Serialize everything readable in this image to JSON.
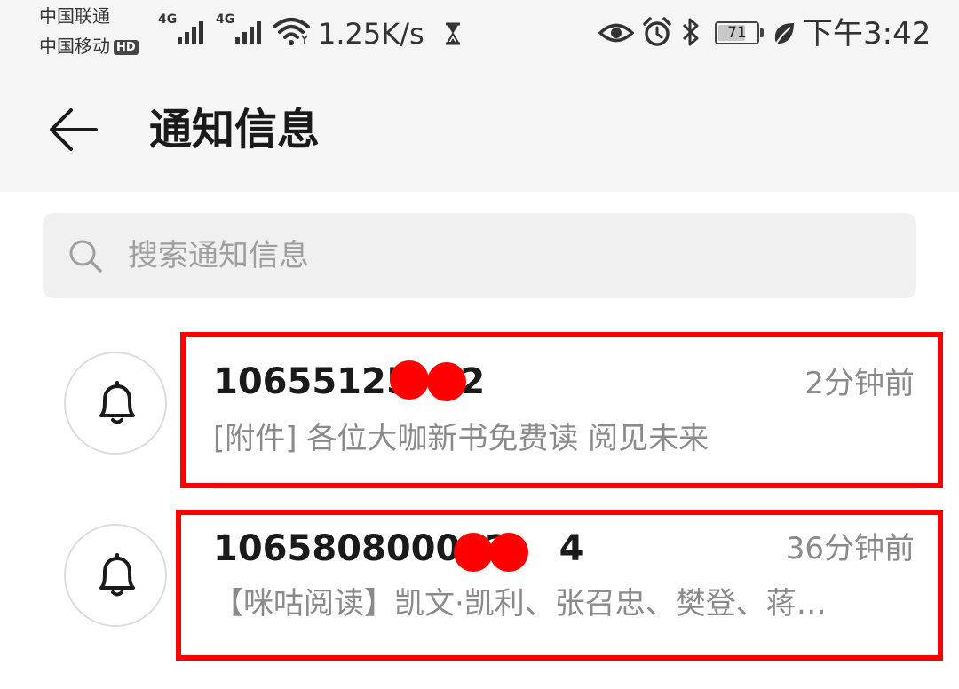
{
  "status_bar": {
    "carrier_1": "中国联通",
    "carrier_2": "中国移动",
    "hd_badge": "HD",
    "signal_1_tag": "4G",
    "signal_2_tag": "4G",
    "net_speed": "1.25K/s",
    "battery_level": "71",
    "battery_fraction": 0.71,
    "time": "下午3:42",
    "icons": [
      "signal-icon",
      "wifi-icon",
      "hourglass-icon",
      "eye-icon",
      "alarm-icon",
      "bluetooth-icon",
      "battery-icon",
      "leaf-icon"
    ]
  },
  "header": {
    "title": "通知信息",
    "back_icon": "arrow-left-icon"
  },
  "search": {
    "placeholder": "搜索通知信息",
    "value": "",
    "icon": "search-icon"
  },
  "notifications": [
    {
      "sender": "10655125",
      "sender_tail": "2",
      "time": "2分钟前",
      "preview": "[附件] 各位大咖新书免费读 阅见未来",
      "icon": "bell-icon"
    },
    {
      "sender": "106580800012",
      "sender_tail": "4",
      "time": "36分钟前",
      "preview": "【咪咕阅读】凯文·凯利、张召忠、樊登、蒋…",
      "icon": "bell-icon"
    }
  ],
  "colors": {
    "highlight": "#ff0000",
    "redaction": "#ff0000",
    "header_bg": "#f5f5f5",
    "search_bg": "#f0f0f0",
    "secondary_text": "#8a8a8a"
  }
}
